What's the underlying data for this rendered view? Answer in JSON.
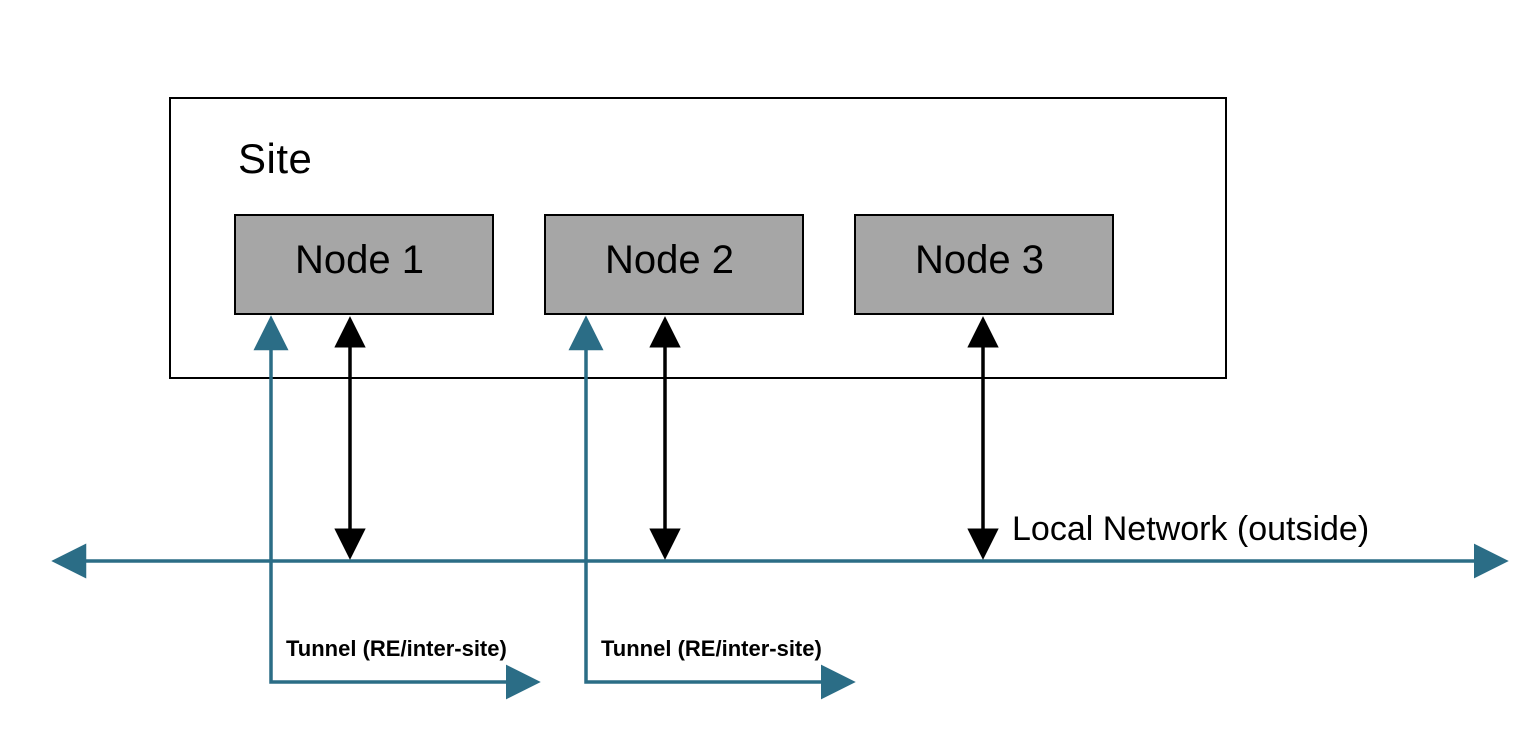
{
  "colors": {
    "teal": "#2b6d86",
    "black": "#000000",
    "nodeFill": "#a6a6a6"
  },
  "site": {
    "label": "Site"
  },
  "nodes": [
    {
      "label": "Node 1"
    },
    {
      "label": "Node 2"
    },
    {
      "label": "Node 3"
    }
  ],
  "network": {
    "label": "Local Network (outside)"
  },
  "tunnels": [
    {
      "label": "Tunnel (RE/inter-site)"
    },
    {
      "label": "Tunnel (RE/inter-site)"
    }
  ]
}
